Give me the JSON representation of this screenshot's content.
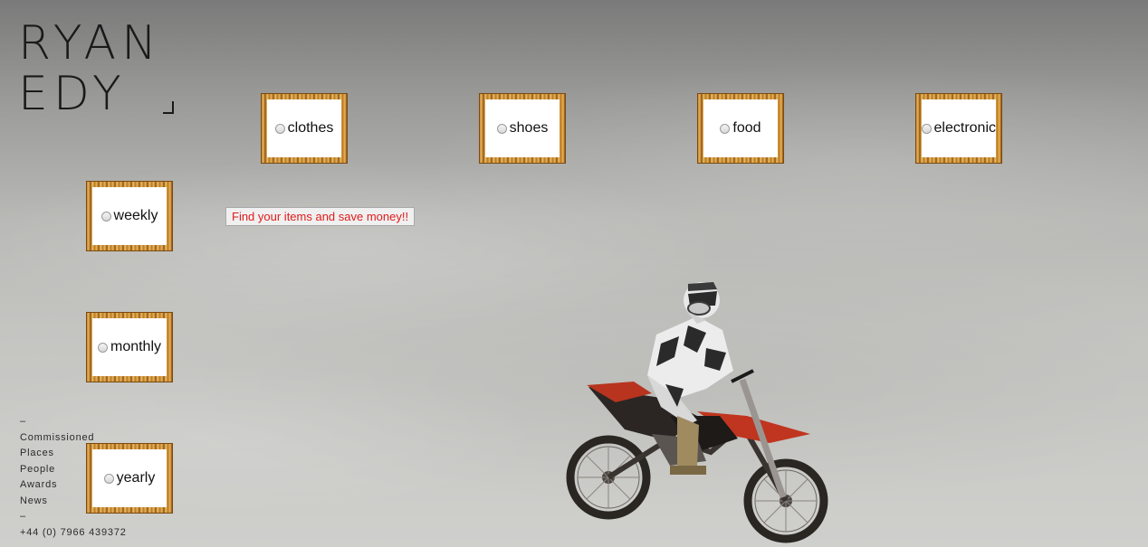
{
  "logo": {
    "line1": "RYAN",
    "line2": "EDY"
  },
  "categories": [
    {
      "label": "clothes"
    },
    {
      "label": "shoes"
    },
    {
      "label": "food"
    },
    {
      "label": "electronic"
    }
  ],
  "periods": [
    {
      "label": "weekly"
    },
    {
      "label": "monthly"
    },
    {
      "label": "yearly"
    }
  ],
  "find_button": {
    "label": "Find your items and save money!!",
    "color": "#e01b1b"
  },
  "nav": {
    "dash1": "–",
    "items": [
      "Commissioned",
      "Places",
      "People",
      "Awards",
      "News"
    ],
    "dash2": "–",
    "phone": "+44 (0) 7966 439372"
  },
  "background": {
    "hero": "motocross-rider-jump"
  }
}
